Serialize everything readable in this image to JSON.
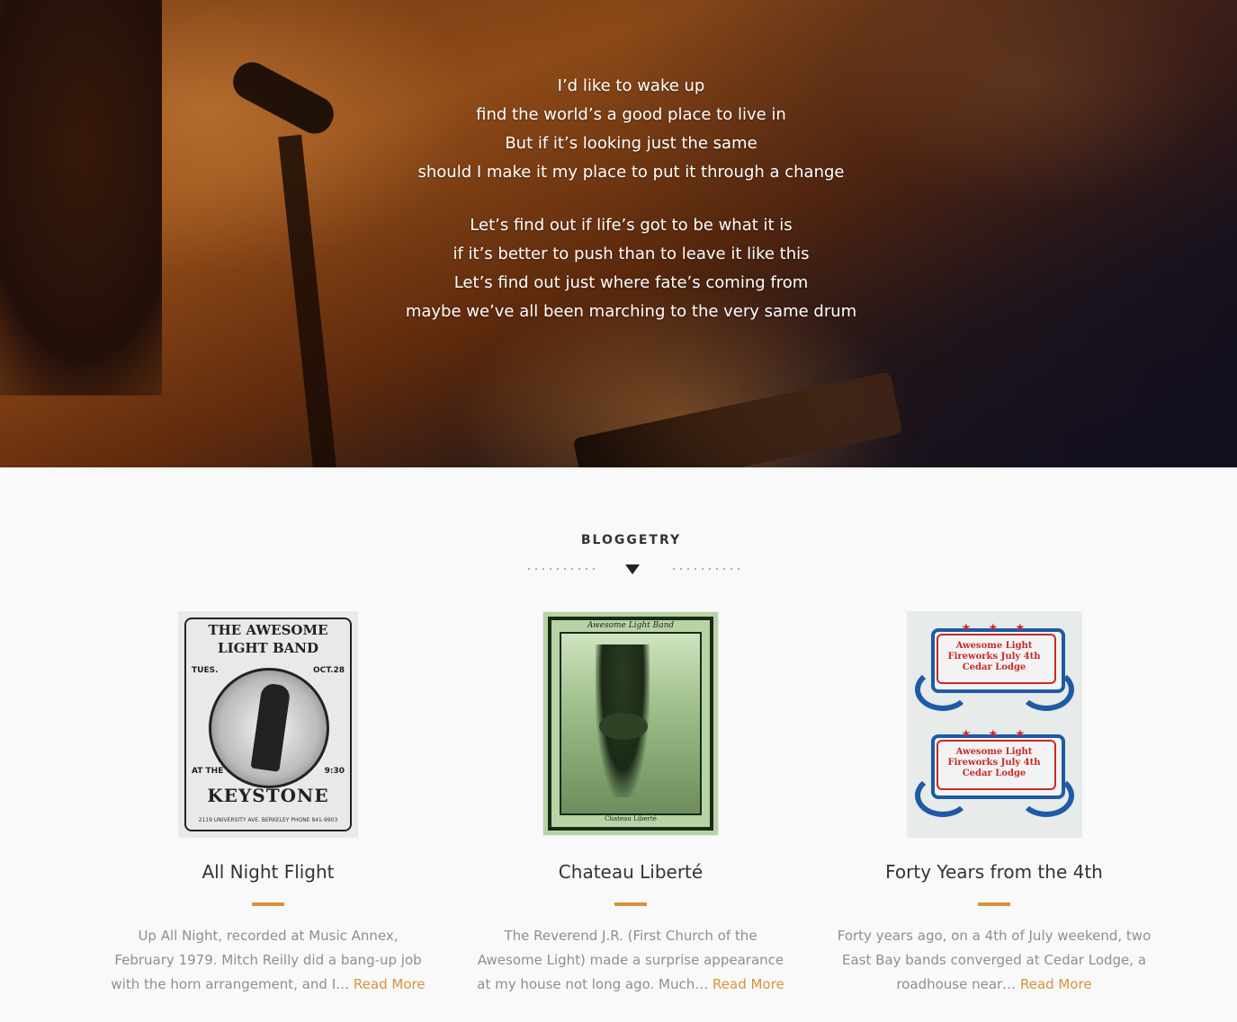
{
  "hero": {
    "verses": [
      [
        "I’d like to wake up",
        "find the world’s a good place to live in",
        "But if it’s looking just the same",
        "should I make it my place to put it through a change"
      ],
      [
        "Let’s find out if life’s got to be what it is",
        "if it’s better to push than to leave it like this",
        "Let’s find out just where fate’s coming from",
        "maybe we’ve all been marching to the very same drum"
      ]
    ]
  },
  "blog": {
    "section_title": "BLOGGETRY",
    "accent_color": "#d6943a",
    "posts": [
      {
        "title": "All Night Flight",
        "excerpt": "Up All Night, recorded at Music Annex, February 1979. Mitch Reilly did a bang-up job with the horn arrangement, and I…",
        "read_more": "Read More",
        "poster": {
          "band": "THE AWESOME LIGHT BAND",
          "day": "TUES.",
          "date": "OCT.28",
          "at": "AT THE",
          "time": "9:30",
          "venue": "KEYSTONE",
          "address": "2119 UNIVERSITY AVE. BERKELEY PHONE 841-9903"
        }
      },
      {
        "title": "Chateau Liberté",
        "excerpt": "The Reverend J.R. (First Church of the Awesome Light) made a surprise appearance at my house not long ago. Much…",
        "read_more": "Read More",
        "poster": {
          "band": "Awesome Light Band",
          "venue": "Chateau Liberté"
        }
      },
      {
        "title": "Forty Years from the 4th",
        "excerpt": "Forty years ago, on a 4th of July weekend,  two East Bay bands converged at Cedar Lodge, a roadhouse near…",
        "read_more": "Read More",
        "poster": {
          "line1": "Awesome Light",
          "line2": "Fireworks July 4th",
          "line3": "Cedar Lodge"
        }
      }
    ]
  }
}
